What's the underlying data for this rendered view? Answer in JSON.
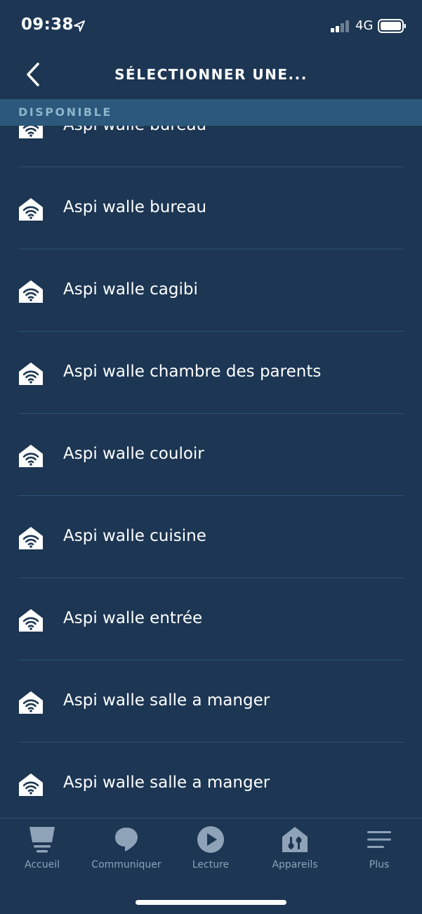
{
  "status_bar": {
    "time": "09:38",
    "network": "4G"
  },
  "nav": {
    "title": "SÉLECTIONNER UNE..."
  },
  "section": {
    "label": "DISPONIBLE"
  },
  "devices": [
    {
      "label": "Aspi walle bureau",
      "icon": "smart-home-wifi-icon"
    },
    {
      "label": "Aspi walle bureau",
      "icon": "smart-home-wifi-icon"
    },
    {
      "label": "Aspi walle cagibi",
      "icon": "smart-home-wifi-icon"
    },
    {
      "label": "Aspi walle chambre des parents",
      "icon": "smart-home-wifi-icon"
    },
    {
      "label": "Aspi walle couloir",
      "icon": "smart-home-wifi-icon"
    },
    {
      "label": "Aspi walle cuisine",
      "icon": "smart-home-wifi-icon"
    },
    {
      "label": "Aspi walle entrée",
      "icon": "smart-home-wifi-icon"
    },
    {
      "label": "Aspi walle salle a manger",
      "icon": "smart-home-wifi-icon"
    },
    {
      "label": "Aspi walle salle a manger",
      "icon": "smart-home-wifi-icon"
    }
  ],
  "tabs": [
    {
      "label": "Accueil",
      "icon": "home-icon"
    },
    {
      "label": "Communiquer",
      "icon": "chat-bubble-icon"
    },
    {
      "label": "Lecture",
      "icon": "play-icon"
    },
    {
      "label": "Appareils",
      "icon": "smart-home-icon"
    },
    {
      "label": "Plus",
      "icon": "menu-icon"
    }
  ],
  "colors": {
    "background": "#1c3653",
    "section_header": "#2b587b",
    "section_text": "#8fb4cc",
    "divider": "#2e5374",
    "tab_label": "#8ea3b8"
  }
}
